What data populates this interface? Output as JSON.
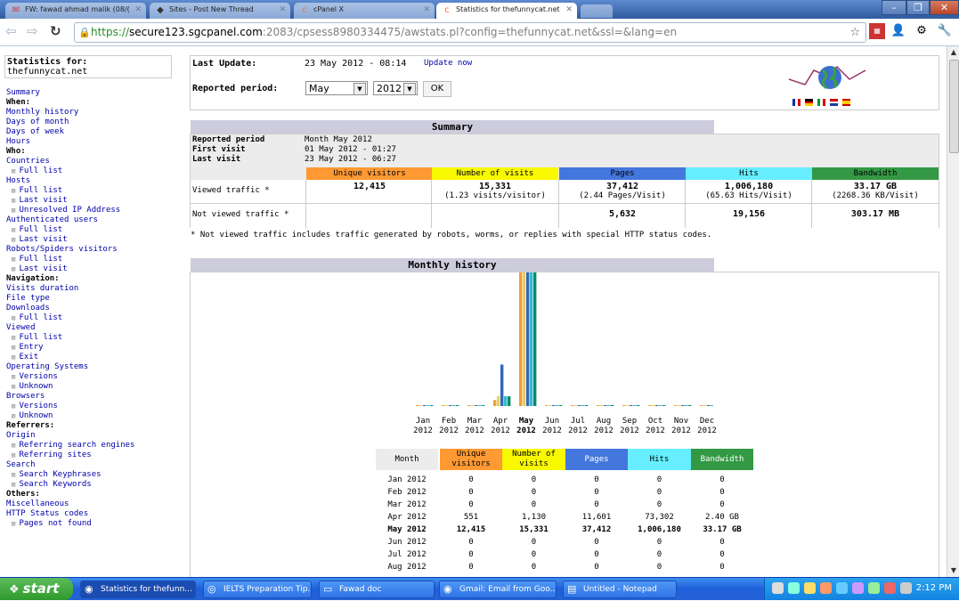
{
  "browser": {
    "tabs": [
      {
        "title": "FW: fawad ahmad malik (08/(",
        "icon": "gmail-icon",
        "left": 6
      },
      {
        "title": "Sites - Post New Thread",
        "icon": "forum-icon",
        "left": 168
      },
      {
        "title": "cPanel X",
        "icon": "cpanel-icon",
        "left": 330
      },
      {
        "title": "Statistics for thefunnycat.net",
        "icon": "cpanel-icon",
        "left": 490,
        "active": true
      }
    ],
    "url_scheme": "https://",
    "url_host": "secure123.sgcpanel.com",
    "url_path": ":2083/cpsess8980334475/awstats.pl?config=thefunnycat.net&ssl=&lang=en",
    "window_buttons": [
      "–",
      "❐",
      "✕"
    ]
  },
  "sidebar": {
    "stats_for_label": "Statistics for:",
    "site": "thefunnycat.net",
    "items": [
      {
        "text": "Summary",
        "type": "lnk"
      },
      {
        "text": "When:",
        "type": "hdr"
      },
      {
        "text": "Monthly history",
        "type": "lnk"
      },
      {
        "text": "Days of month",
        "type": "lnk"
      },
      {
        "text": "Days of week",
        "type": "lnk"
      },
      {
        "text": "Hours",
        "type": "lnk"
      },
      {
        "text": "Who:",
        "type": "hdr"
      },
      {
        "text": "Countries",
        "type": "lnk"
      },
      {
        "text": "Full list",
        "type": "sub"
      },
      {
        "text": "Hosts",
        "type": "lnk"
      },
      {
        "text": "Full list",
        "type": "sub"
      },
      {
        "text": "Last visit",
        "type": "sub"
      },
      {
        "text": "Unresolved IP Address",
        "type": "sub"
      },
      {
        "text": "Authenticated users",
        "type": "lnk"
      },
      {
        "text": "Full list",
        "type": "sub"
      },
      {
        "text": "Last visit",
        "type": "sub"
      },
      {
        "text": "Robots/Spiders visitors",
        "type": "lnk"
      },
      {
        "text": "Full list",
        "type": "sub"
      },
      {
        "text": "Last visit",
        "type": "sub"
      },
      {
        "text": "Navigation:",
        "type": "hdr"
      },
      {
        "text": "Visits duration",
        "type": "lnk"
      },
      {
        "text": "File type",
        "type": "lnk"
      },
      {
        "text": "Downloads",
        "type": "lnk"
      },
      {
        "text": "Full list",
        "type": "sub"
      },
      {
        "text": "Viewed",
        "type": "lnk"
      },
      {
        "text": "Full list",
        "type": "sub"
      },
      {
        "text": "Entry",
        "type": "sub"
      },
      {
        "text": "Exit",
        "type": "sub"
      },
      {
        "text": "Operating Systems",
        "type": "lnk"
      },
      {
        "text": "Versions",
        "type": "sub"
      },
      {
        "text": "Unknown",
        "type": "sub"
      },
      {
        "text": "Browsers",
        "type": "lnk"
      },
      {
        "text": "Versions",
        "type": "sub"
      },
      {
        "text": "Unknown",
        "type": "sub"
      },
      {
        "text": "Referrers:",
        "type": "hdr"
      },
      {
        "text": "Origin",
        "type": "lnk"
      },
      {
        "text": "Referring search engines",
        "type": "sub"
      },
      {
        "text": "Referring sites",
        "type": "sub"
      },
      {
        "text": "Search",
        "type": "lnk"
      },
      {
        "text": "Search Keyphrases",
        "type": "sub"
      },
      {
        "text": "Search Keywords",
        "type": "sub"
      },
      {
        "text": "Others:",
        "type": "hdr"
      },
      {
        "text": "Miscellaneous",
        "type": "lnk"
      },
      {
        "text": "HTTP Status codes",
        "type": "lnk"
      },
      {
        "text": "Pages not found",
        "type": "sub"
      }
    ]
  },
  "update": {
    "last_update_label": "Last Update:",
    "last_update_value": "23 May 2012 - 08:14",
    "update_now": "Update now",
    "reported_period_label": "Reported period:",
    "month_value": "May",
    "year_value": "2012",
    "ok_label": "OK"
  },
  "summary": {
    "title": "Summary",
    "reported_period_label": "Reported period",
    "reported_period_value": "Month May 2012",
    "first_visit_label": "First visit",
    "first_visit_value": "01 May 2012 - 01:27",
    "last_visit_label": "Last visit",
    "last_visit_value": "23 May 2012 - 06:27",
    "columns": [
      "Unique visitors",
      "Number of visits",
      "Pages",
      "Hits",
      "Bandwidth"
    ],
    "column_colors": [
      "#ff9933",
      "#f8f800",
      "#4477dd",
      "#66eeff",
      "#339944"
    ],
    "viewed_label": "Viewed traffic *",
    "viewed": [
      "12,415",
      "15,331",
      "37,412",
      "1,006,180",
      "33.17 GB"
    ],
    "viewed_sub": [
      "",
      "(1.23 visits/visitor)",
      "(2.44 Pages/Visit)",
      "(65.63 Hits/Visit)",
      "(2268.36 KB/Visit)"
    ],
    "not_viewed_label": "Not viewed traffic *",
    "not_viewed": [
      "",
      "",
      "5,632",
      "19,156",
      "303.17 MB"
    ],
    "note": "* Not viewed traffic includes traffic generated by robots, worms, or replies with special HTTP status codes."
  },
  "monthly": {
    "title": "Monthly history",
    "table_headers": [
      "Month",
      "Unique visitors",
      "Number of visits",
      "Pages",
      "Hits",
      "Bandwidth"
    ],
    "rows": [
      {
        "month": "Jan 2012",
        "cells": [
          "0",
          "0",
          "0",
          "0",
          "0"
        ]
      },
      {
        "month": "Feb 2012",
        "cells": [
          "0",
          "0",
          "0",
          "0",
          "0"
        ]
      },
      {
        "month": "Mar 2012",
        "cells": [
          "0",
          "0",
          "0",
          "0",
          "0"
        ]
      },
      {
        "month": "Apr 2012",
        "cells": [
          "551",
          "1,130",
          "11,601",
          "73,302",
          "2.40 GB"
        ]
      },
      {
        "month": "May 2012",
        "cells": [
          "12,415",
          "15,331",
          "37,412",
          "1,006,180",
          "33.17 GB"
        ],
        "bold": true
      },
      {
        "month": "Jun 2012",
        "cells": [
          "0",
          "0",
          "0",
          "0",
          "0"
        ]
      },
      {
        "month": "Jul 2012",
        "cells": [
          "0",
          "0",
          "0",
          "0",
          "0"
        ]
      },
      {
        "month": "Aug 2012",
        "cells": [
          "0",
          "0",
          "0",
          "0",
          "0"
        ]
      }
    ]
  },
  "chart_data": {
    "type": "bar",
    "categories": [
      "Jan 2012",
      "Feb 2012",
      "Mar 2012",
      "Apr 2012",
      "May 2012",
      "Jun 2012",
      "Jul 2012",
      "Aug 2012",
      "Sep 2012",
      "Oct 2012",
      "Nov 2012",
      "Dec 2012"
    ],
    "month_labels": [
      "Jan",
      "Feb",
      "Mar",
      "Apr",
      "May",
      "Jun",
      "Jul",
      "Aug",
      "Sep",
      "Oct",
      "Nov",
      "Dec"
    ],
    "year_label": "2012",
    "series": [
      {
        "name": "Unique visitors",
        "color": "#f0a030",
        "values": [
          0,
          0,
          0,
          551,
          12415,
          0,
          0,
          0,
          0,
          0,
          0,
          0
        ]
      },
      {
        "name": "Number of visits",
        "color": "#e8d060",
        "values": [
          0,
          0,
          0,
          1130,
          15331,
          0,
          0,
          0,
          0,
          0,
          0,
          0
        ]
      },
      {
        "name": "Pages",
        "color": "#3366bb",
        "values": [
          0,
          0,
          0,
          11601,
          37412,
          0,
          0,
          0,
          0,
          0,
          0,
          0
        ]
      },
      {
        "name": "Hits",
        "color": "#33bbcc",
        "values": [
          0,
          0,
          0,
          73302,
          1006180,
          0,
          0,
          0,
          0,
          0,
          0,
          0
        ]
      },
      {
        "name": "Bandwidth",
        "color": "#118866",
        "values": [
          0,
          0,
          0,
          2.4,
          33.17,
          0,
          0,
          0,
          0,
          0,
          0,
          0
        ]
      }
    ]
  },
  "taskbar": {
    "start": "start",
    "items": [
      {
        "text": "Statistics for thefunn...",
        "icon": "chrome-icon",
        "active": true
      },
      {
        "text": "IELTS Preparation Tip...",
        "icon": "firefox-icon"
      },
      {
        "text": "Fawad doc",
        "icon": "folder-icon"
      },
      {
        "text": "Gmail: Email from Goo...",
        "icon": "chrome-icon"
      },
      {
        "text": "Untitled - Notepad",
        "icon": "notepad-icon"
      }
    ],
    "time": "2:12 PM"
  }
}
